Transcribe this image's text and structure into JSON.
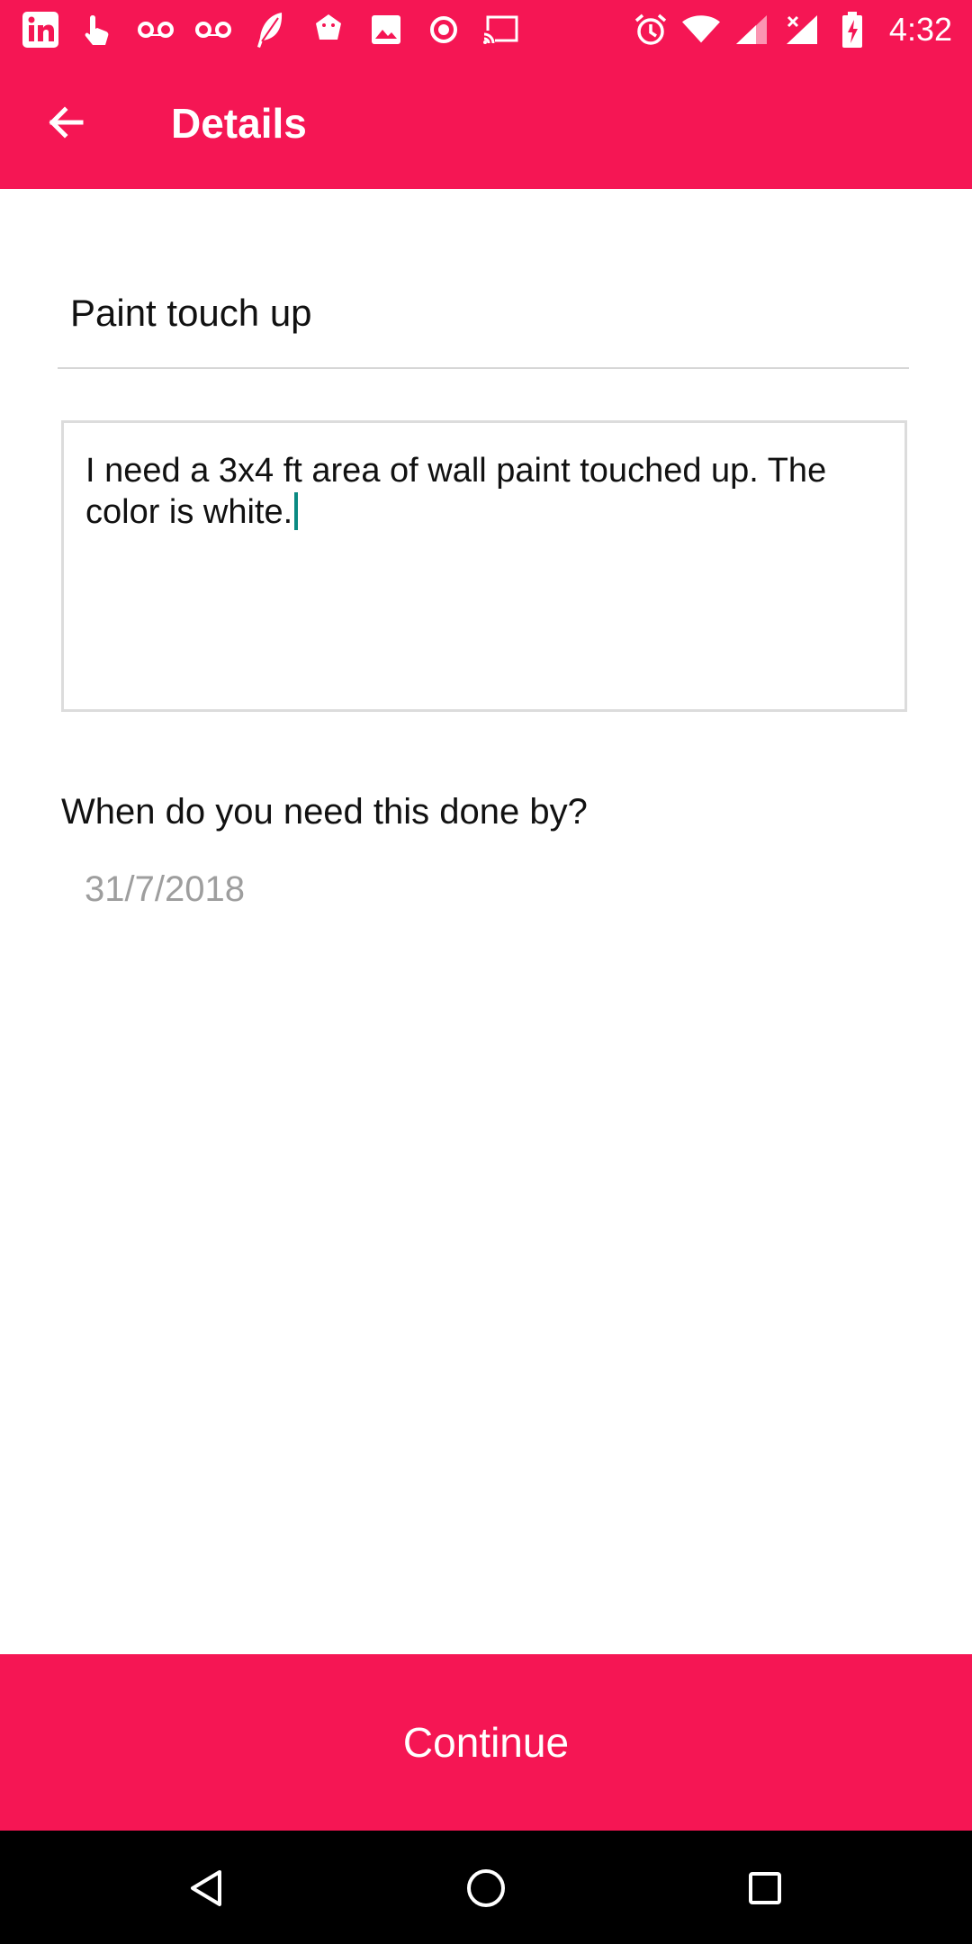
{
  "status_bar": {
    "left_icons": [
      "linkedin-icon",
      "touch-icon",
      "voicemail-icon",
      "voicemail-icon",
      "feather-icon",
      "android-icon",
      "image-icon",
      "record-icon",
      "cast-icon"
    ],
    "right_icons": [
      "alarm-icon",
      "wifi-icon",
      "signal-icon",
      "signal-no-data-icon",
      "battery-charging-icon"
    ],
    "time": "4:32"
  },
  "toolbar": {
    "title": "Details",
    "back_icon": "arrow-back-icon"
  },
  "form": {
    "title_value": "Paint touch up",
    "description_value": "I need a 3x4 ft area of wall paint touched up. The color is white.",
    "due_question": "When do you need this done by?",
    "due_date": "31/7/2018"
  },
  "actions": {
    "continue_label": "Continue"
  },
  "colors": {
    "accent": "#f51654",
    "caret": "#0a8a82",
    "date_gray": "#9e9e9e"
  },
  "nav_bar": {
    "icons": [
      "back-triangle-icon",
      "home-circle-icon",
      "recents-square-icon"
    ]
  }
}
